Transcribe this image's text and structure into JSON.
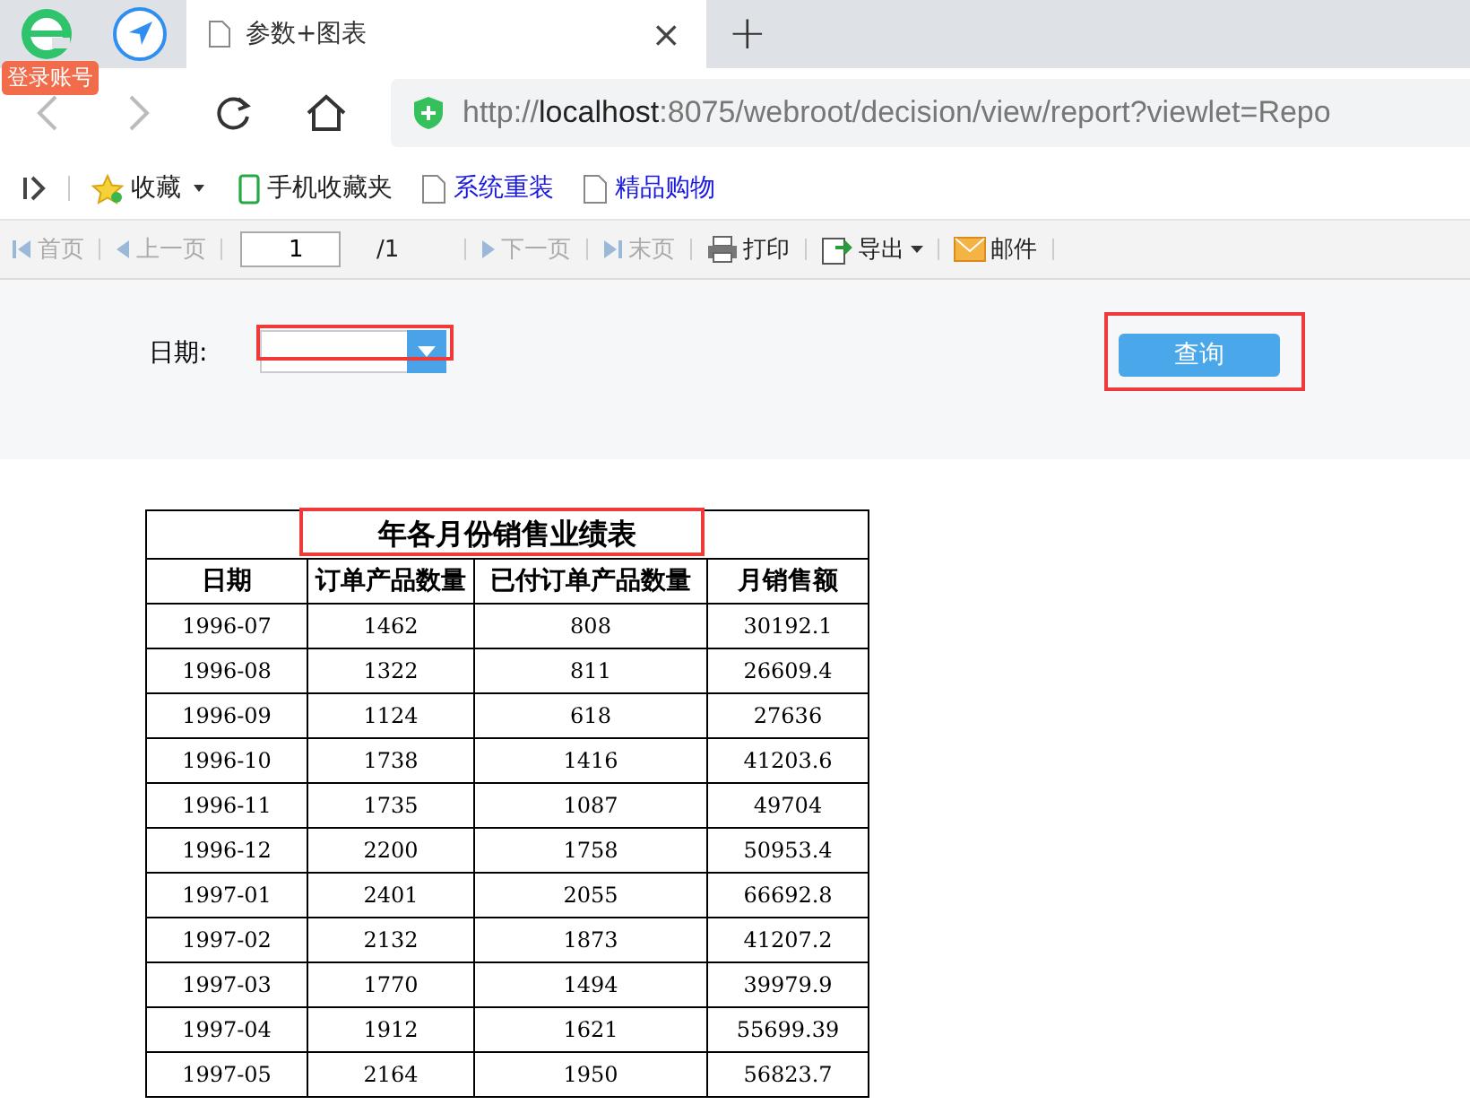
{
  "browser": {
    "badge": "登录账号",
    "tab": {
      "title": "参数+图表",
      "close": "×"
    },
    "new_tab": "+",
    "url": "http://**localhost**:8075/webroot/decision/view/report?viewlet=Repo"
  },
  "bookmarks": [
    {
      "label": "收藏",
      "kind": "menu"
    },
    {
      "label": "手机收藏夹",
      "kind": "folder"
    },
    {
      "label": "系统重装",
      "kind": "link"
    },
    {
      "label": "精品购物",
      "kind": "link"
    }
  ],
  "toolbar": {
    "items": [
      {
        "label": "首页",
        "kind": "first",
        "disabled": true
      },
      {
        "label": "上一页",
        "kind": "prev",
        "disabled": true
      }
    ],
    "page": "1",
    "total": "/1",
    "items2": [
      {
        "label": "下一页",
        "kind": "next",
        "disabled": true
      },
      {
        "label": "末页",
        "kind": "last",
        "disabled": true
      },
      {
        "label": "打印",
        "kind": "print",
        "disabled": false
      },
      {
        "label": "导出",
        "kind": "export",
        "disabled": false
      },
      {
        "label": "邮件",
        "kind": "mail",
        "disabled": false
      }
    ]
  },
  "params": {
    "date_label": "日期:",
    "query_button": "查询"
  },
  "report": {
    "title": "年各月份销售业绩表",
    "columns": [
      "日期",
      "订单产品数量",
      "已付订单产品数量",
      "月销售额"
    ],
    "rows": [
      [
        "1996-07",
        "1462",
        "808",
        "30192.1"
      ],
      [
        "1996-08",
        "1322",
        "811",
        "26609.4"
      ],
      [
        "1996-09",
        "1124",
        "618",
        "27636"
      ],
      [
        "1996-10",
        "1738",
        "1416",
        "41203.6"
      ],
      [
        "1996-11",
        "1735",
        "1087",
        "49704"
      ],
      [
        "1996-12",
        "2200",
        "1758",
        "50953.4"
      ],
      [
        "1997-01",
        "2401",
        "2055",
        "66692.8"
      ],
      [
        "1997-02",
        "2132",
        "1873",
        "41207.2"
      ],
      [
        "1997-03",
        "1770",
        "1494",
        "39979.9"
      ],
      [
        "1997-04",
        "1912",
        "1621",
        "55699.39"
      ],
      [
        "1997-05",
        "2164",
        "1950",
        "56823.7"
      ]
    ]
  }
}
